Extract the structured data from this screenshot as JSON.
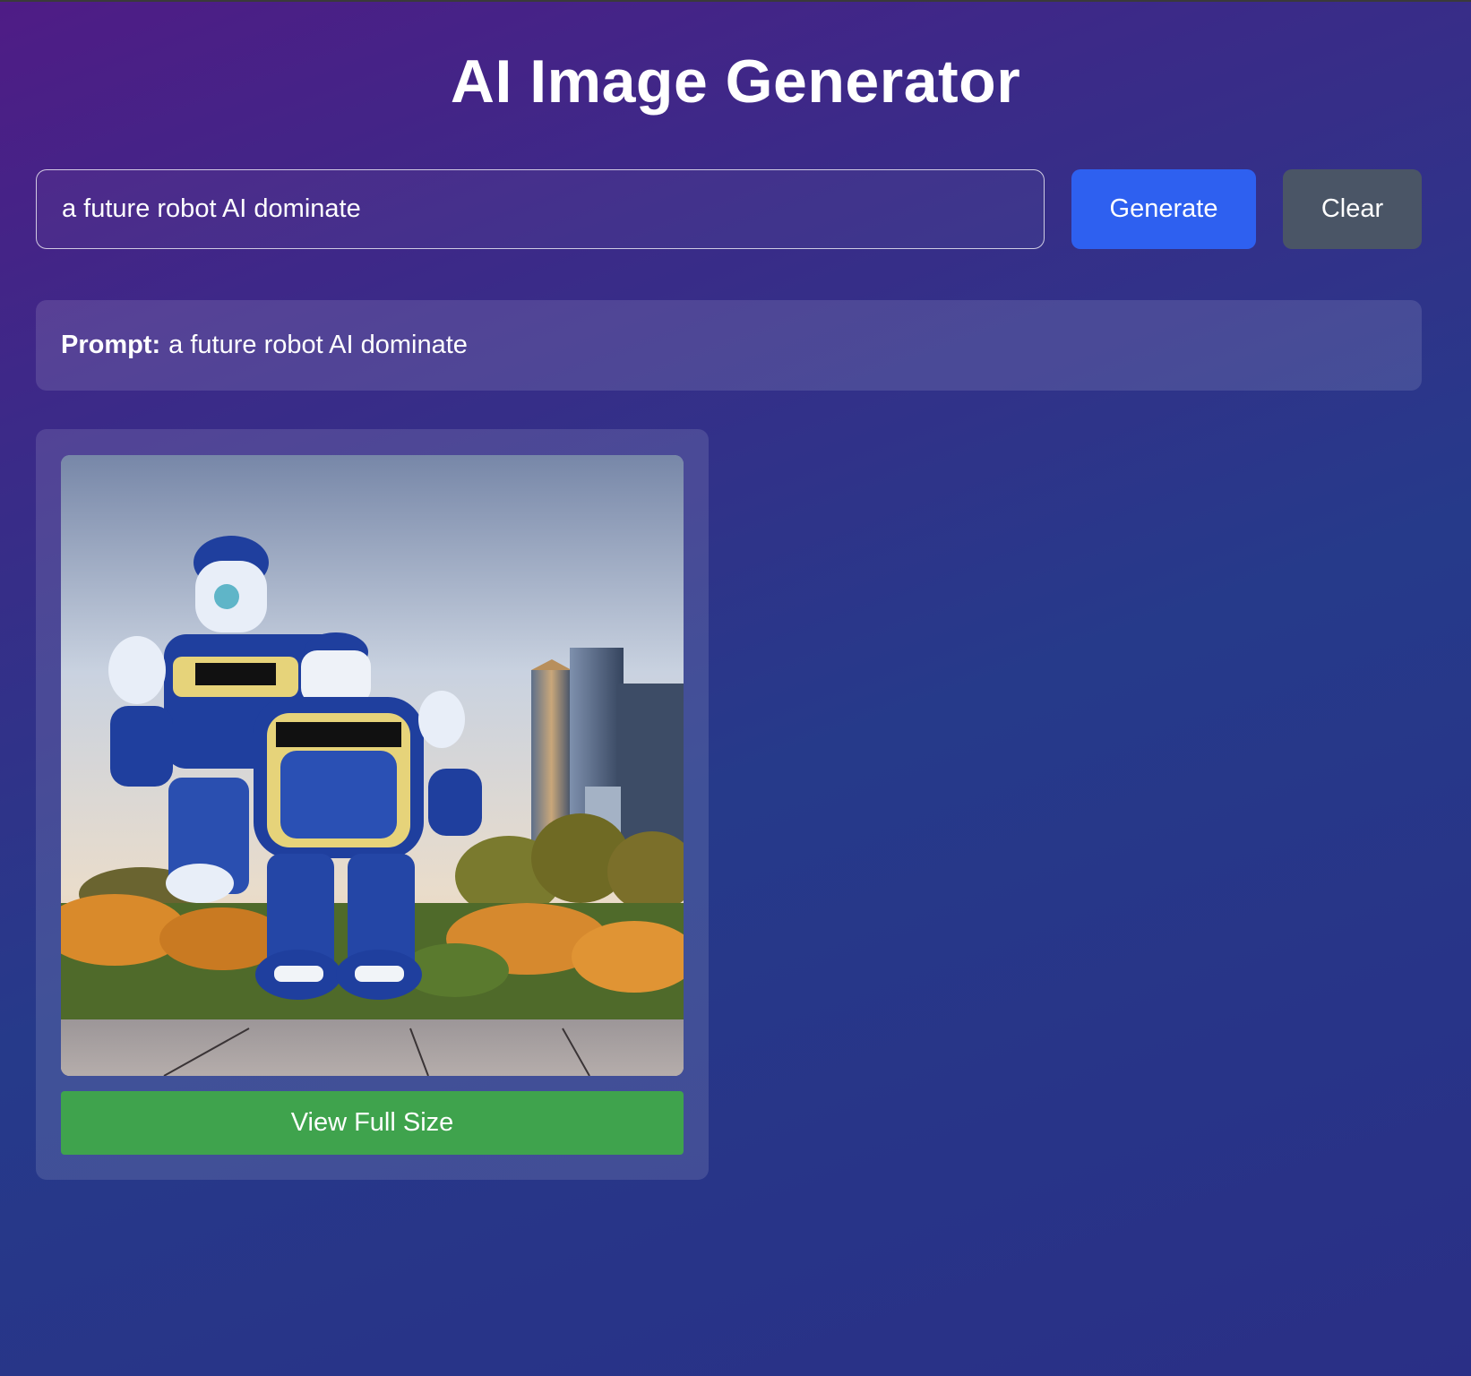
{
  "header": {
    "title": "AI Image Generator"
  },
  "input": {
    "value": "a future robot AI dominate",
    "placeholder": ""
  },
  "buttons": {
    "generate_label": "Generate",
    "clear_label": "Clear"
  },
  "prompt_display": {
    "label": "Prompt:",
    "text": "a future robot AI dominate"
  },
  "result": {
    "view_label": "View Full Size"
  },
  "colors": {
    "generate": "#2e60f0",
    "clear": "#4a5566",
    "view": "#3fa34d",
    "robot_blue": "#1f3f9e"
  }
}
